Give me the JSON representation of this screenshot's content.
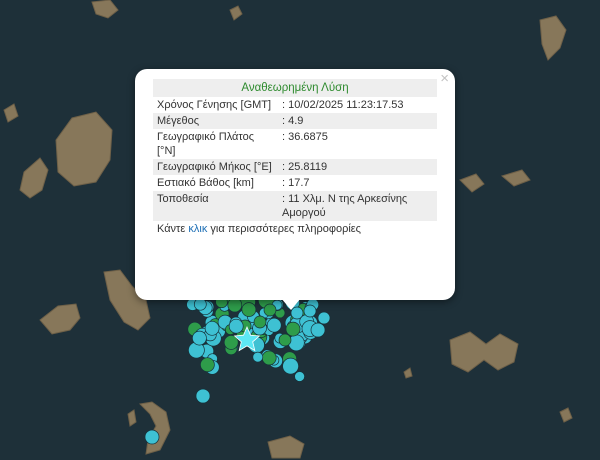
{
  "popup": {
    "title": "Αναθεωρημένη Λύση",
    "close_icon": "close-x-icon",
    "rows": [
      {
        "label": "Χρόνος Γένησης [GMT]",
        "value": ": 10/02/2025 11:23:17.53"
      },
      {
        "label": "Μέγεθος",
        "value": ": 4.9"
      },
      {
        "label": "Γεωγραφικό Πλάτος [°N]",
        "value": ": 36.6875"
      },
      {
        "label": "Γεωγραφικό Μήκος [°E]",
        "value": ": 25.8119"
      },
      {
        "label": "Εστιακό Βάθος [km]",
        "value": ": 17.7"
      },
      {
        "label": "Τοποθεσία",
        "value": ": 11 Χλμ. Ν της Αρκεσίνης Αμοργού"
      }
    ],
    "more_prefix": "Κάντε ",
    "more_link": "κλικ",
    "more_suffix": " για περισσότερες πληροφορίες"
  },
  "map": {
    "epicenter_icon": "star-icon",
    "colors": {
      "sea": "#1d2f38",
      "land": "#8a7a5e",
      "quake_cyan": "#3ec1d3",
      "quake_green": "#2e9c4a",
      "epicenter": "#5de8f5"
    }
  }
}
